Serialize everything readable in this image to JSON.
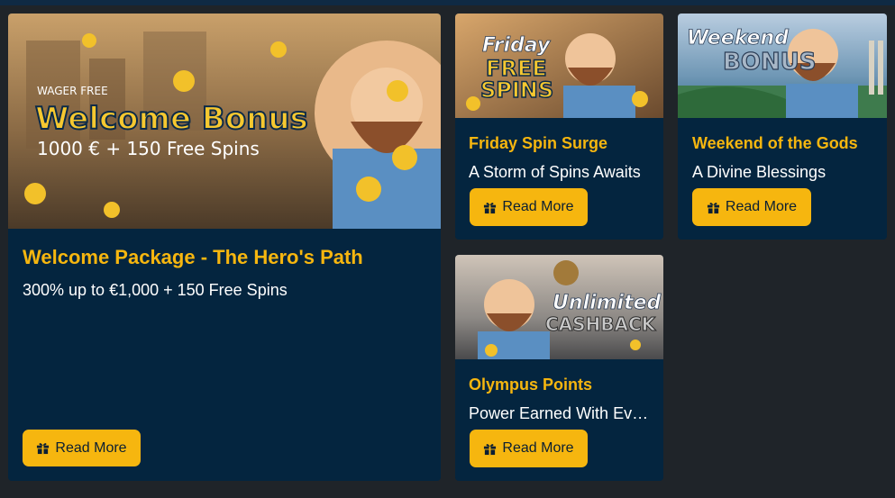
{
  "colors": {
    "accent": "#f6b60f",
    "card_bg": "#04253f",
    "page_bg": "#1f2429"
  },
  "promotions": [
    {
      "title": "Welcome Package - The Hero's Path",
      "description": "300% up to €1,000 + 150 Free Spins",
      "button_label": "Read More",
      "banner": {
        "line1": "WAGER FREE",
        "line2": "Welcome Bonus",
        "line3": "1000 € + 150 Free Spins"
      }
    },
    {
      "title": "Friday Spin Surge",
      "description": "A Storm of Spins Awaits",
      "button_label": "Read More",
      "banner": {
        "line1": "Friday",
        "line2": "FREE",
        "line3": "SPINS"
      }
    },
    {
      "title": "Weekend of the Gods",
      "description": "A Divine Blessings",
      "button_label": "Read More",
      "banner": {
        "line1": "Weekend",
        "line2": "BONUS"
      }
    },
    {
      "title": "Olympus Points",
      "description": "Power Earned With Every Bet",
      "button_label": "Read More",
      "banner": {
        "line1": "Unlimited",
        "line2": "CASHBACK"
      }
    }
  ],
  "icons": {
    "button_icon": "gift-icon"
  }
}
